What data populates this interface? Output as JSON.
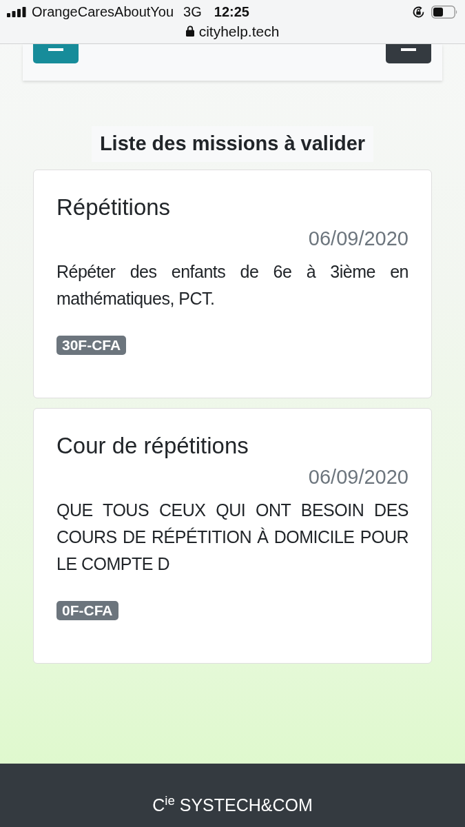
{
  "status_bar": {
    "carrier": "OrangeCaresAboutYou",
    "network": "3G",
    "time": "12:25"
  },
  "address_bar": {
    "url": "cityhelp.tech"
  },
  "navbar": {
    "buttons": [
      {
        "kind": "menu",
        "color": "#178c9a"
      },
      {
        "kind": "menu",
        "color": "#343a40"
      }
    ]
  },
  "heading": "Liste des missions à valider",
  "missions": [
    {
      "title": "Répétitions",
      "date": "06/09/2020",
      "description": "Répéter des enfants de 6e à 3ième en mathématiques, PCT.",
      "price": "30F-CFA"
    },
    {
      "title": "Cour de répétitions",
      "date": "06/09/2020",
      "description": "QUE TOUS CEUX QUI ONT BESOIN DES COURS DE RÉPÉTITION À DOMICILE POUR LE COMPTE D",
      "price": "0F-CFA"
    }
  ],
  "footer": {
    "text": "C$^{ie}$ SYSTECH&COM"
  }
}
